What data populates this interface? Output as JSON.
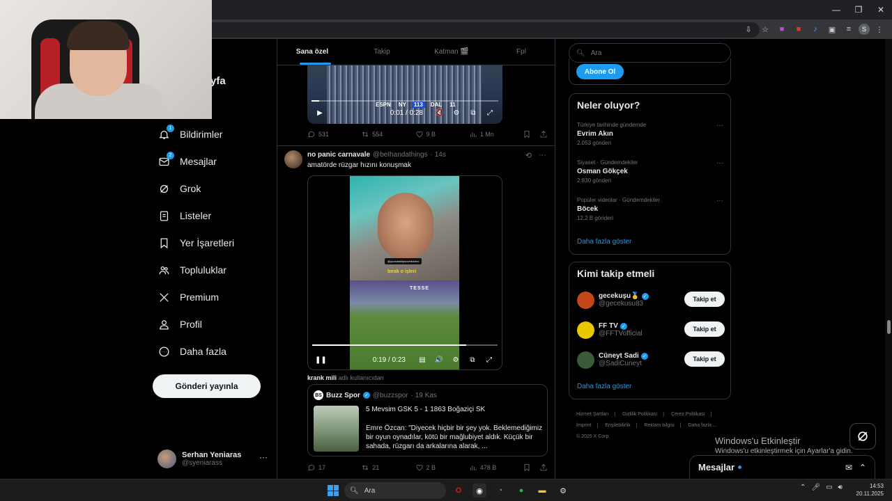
{
  "webcam": {
    "partial_nav_text": "yfa"
  },
  "nav": {
    "items": [
      {
        "label": "Bildirimler",
        "icon": "bell-icon",
        "badge": "1"
      },
      {
        "label": "Mesajlar",
        "icon": "mail-icon",
        "badge": "2"
      },
      {
        "label": "Grok",
        "icon": "grok-icon"
      },
      {
        "label": "Listeler",
        "icon": "list-icon"
      },
      {
        "label": "Yer İşaretleri",
        "icon": "bookmark-icon"
      },
      {
        "label": "Topluluklar",
        "icon": "people-icon"
      },
      {
        "label": "Premium",
        "icon": "x-logo-icon"
      },
      {
        "label": "Profil",
        "icon": "person-icon"
      },
      {
        "label": "Daha fazla",
        "icon": "more-circle-icon"
      }
    ],
    "post_button": "Gönderi yayınla",
    "profile": {
      "name": "Serhan Yeniaras",
      "handle": "@syeniarass",
      "more": "···"
    }
  },
  "tabs": [
    {
      "label": "Sana özel",
      "active": true
    },
    {
      "label": "Takip"
    },
    {
      "label": "Katman 🎬"
    },
    {
      "label": "Fpl"
    }
  ],
  "top_video": {
    "score_left": "NY",
    "score_left_val": "113",
    "score_right": "DAL",
    "score_right_val": "11",
    "network": "ESPN",
    "time": "0:01 / 0:28",
    "progress": 0.04,
    "actions": {
      "replies": "531",
      "reposts": "554",
      "likes": "9 B",
      "views": "1 Mn"
    }
  },
  "tweet": {
    "name": "no panic carnavale",
    "handle": "@beIhandathings",
    "time": "· 14s",
    "text": "amatörde rüzgar hızını konuşmak",
    "video": {
      "tag": "@youtubeklipsoverfulden",
      "caption": "bırak o işleri",
      "ad_text": "TESSE",
      "time": "0:19 / 0:23",
      "progress": 0.83
    },
    "quote_meta_user": "krank mili",
    "quote_meta_text": "adlı kullanıcıdan",
    "quote": {
      "logo": "BS",
      "name": "Buzz Spor",
      "handle": "@buzzspor",
      "time": "· 19 Kas",
      "title": "5 Mevsim GSK 5 - 1 1863 Boğaziçi SK",
      "body": "Emre Özcan: \"Diyecek hiçbir bir şey yok. Beklemediğimiz bir oyun oynadılar, kötü bir mağlubiyet aldık. Küçük bir sahada, rüzgarı da arkalarına alarak, ..."
    },
    "actions": {
      "replies": "17",
      "reposts": "21",
      "likes": "2 B",
      "views": "478 B"
    }
  },
  "right": {
    "search_placeholder": "Ara",
    "subscribe_button": "Abone Ol",
    "trends_title": "Neler oluyor?",
    "trends": [
      {
        "meta": "Türkiye tarihinde gündemde",
        "topic": "Evrim Akın",
        "count": "2.053 gönderi"
      },
      {
        "meta": "Siyaset · Gündemdekiler",
        "topic": "Osman Gökçek",
        "count": "2.830 gönderi"
      },
      {
        "meta": "Popüler videolar · Gündemdekiler",
        "topic": "Böcek",
        "count": "12,2 B gönderi"
      }
    ],
    "trends_more": "Daha fazla göster",
    "wtf_title": "Kimi takip etmeli",
    "wtf": [
      {
        "name": "gecekuşu🥇",
        "handle": "@gecekusu83",
        "button": "Takip et",
        "color": "#c1471b"
      },
      {
        "name": "FF TV",
        "handle": "@FFTVofficial",
        "button": "Takip et",
        "color": "#e6c800"
      },
      {
        "name": "Cüneyt Sadi",
        "handle": "@SadiCuneyt",
        "button": "Takip et",
        "color": "#3a5a3a"
      }
    ],
    "wtf_more": "Daha fazla göster",
    "footer": [
      "Hizmet Şartları",
      "|",
      "Gizlilik Politikası",
      "|",
      "Çerez Politikası",
      "|",
      "İmprint",
      "|",
      "Erişilebilirlik",
      "|",
      "Reklam bilgisi",
      "|",
      "Daha fazla ...",
      "© 2025 X Corp."
    ]
  },
  "windows_activate": {
    "line1": "Windows'u Etkinleştir",
    "line2": "Windows'u etkinleştirmek için Ayarlar'a gidin."
  },
  "messages_drawer": {
    "title": "Mesajlar"
  },
  "taskbar": {
    "search": "Ara",
    "time": "14:53",
    "date": "20.11.2025"
  }
}
